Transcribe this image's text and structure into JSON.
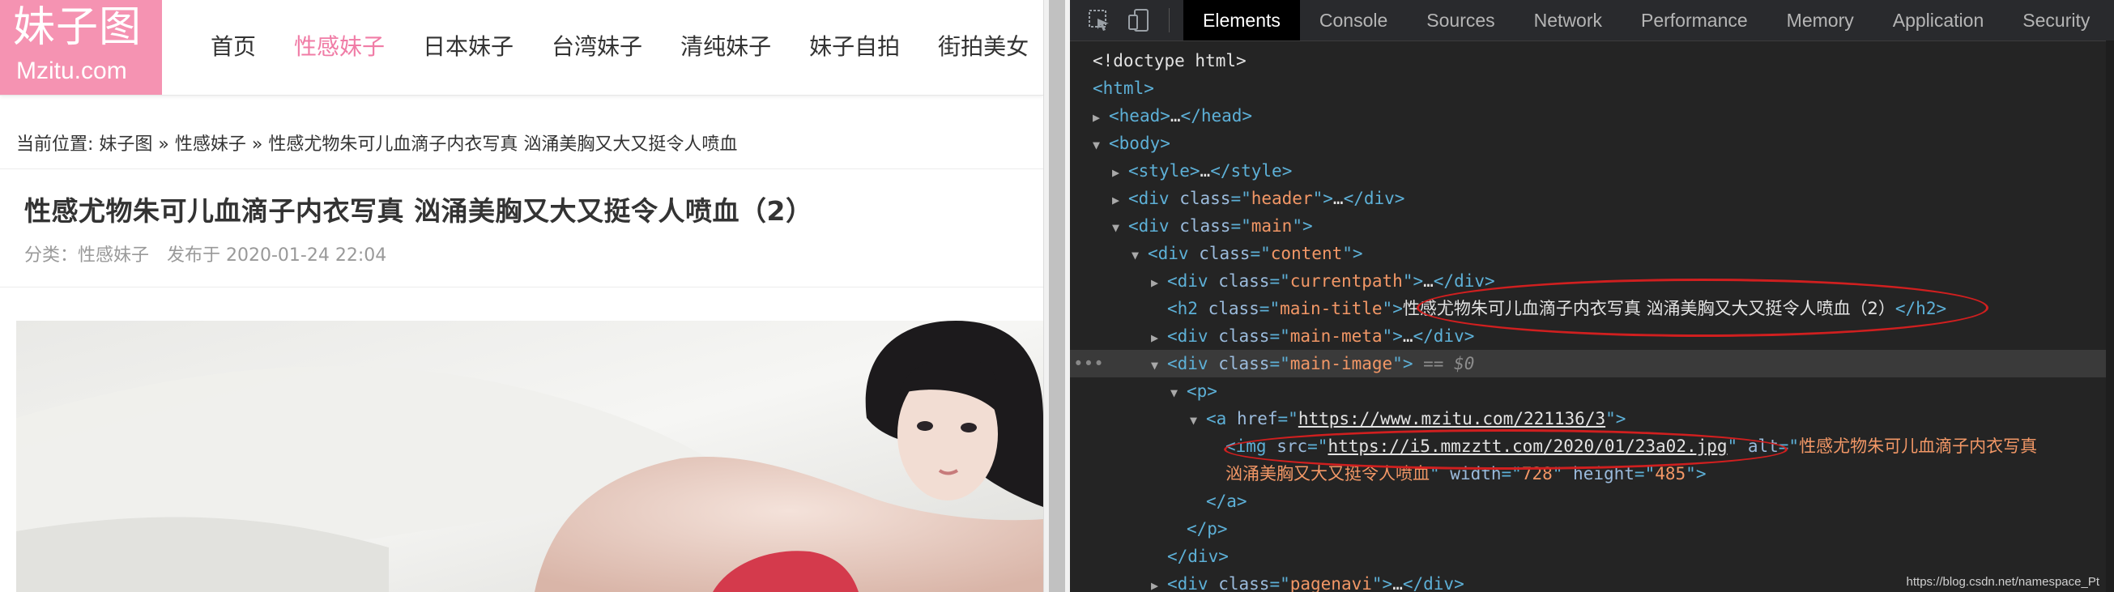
{
  "site": {
    "logo": {
      "cn": "妹子图",
      "en": "Mzitu.com"
    },
    "nav": [
      {
        "label": "首页",
        "active": false
      },
      {
        "label": "性感妹子",
        "active": true
      },
      {
        "label": "日本妹子",
        "active": false
      },
      {
        "label": "台湾妹子",
        "active": false
      },
      {
        "label": "清纯妹子",
        "active": false
      },
      {
        "label": "妹子自拍",
        "active": false
      },
      {
        "label": "街拍美女",
        "active": false
      }
    ],
    "breadcrumb": {
      "prefix": "当前位置: ",
      "home": "妹子图",
      "sep1": " » ",
      "category": "性感妹子",
      "sep2": " » ",
      "current": "性感尤物朱可儿血滴子内衣写真 汹涌美胸又大又挺令人喷血"
    },
    "title": "性感尤物朱可儿血滴子内衣写真 汹涌美胸又大又挺令人喷血（2）",
    "meta": {
      "category": "分类：性感妹子",
      "published": "发布于 2020-01-24 22:04"
    }
  },
  "devtools": {
    "tabs": [
      {
        "label": "Elements",
        "active": true
      },
      {
        "label": "Console",
        "active": false
      },
      {
        "label": "Sources",
        "active": false
      },
      {
        "label": "Network",
        "active": false
      },
      {
        "label": "Performance",
        "active": false
      },
      {
        "label": "Memory",
        "active": false
      },
      {
        "label": "Application",
        "active": false
      },
      {
        "label": "Security",
        "active": false
      }
    ],
    "icons": [
      "inspect-element-icon",
      "device-toolbar-icon"
    ],
    "dom": {
      "doctype": "<!doctype html>",
      "html_open": "<html>",
      "head_tag": "head",
      "body_tag": "body",
      "style_tag": "style",
      "header_class": "header",
      "main_class": "main",
      "content_class": "content",
      "currentpath_class": "currentpath",
      "h2_class": "main-title",
      "h2_text": "性感尤物朱可儿血滴子内衣写真 汹涌美胸又大又挺令人喷血（2）",
      "meta_class": "main-meta",
      "image_class": "main-image",
      "selected_marker": "== $0",
      "a_href": "https://www.mzitu.com/221136/3",
      "img_src": "https://i5.mmzztt.com/2020/01/23a02.jpg",
      "img_alt_1": "性感尤物朱可儿血滴子内衣写真",
      "img_alt_2": "汹涌美胸又大又挺令人喷血",
      "img_width": "728",
      "img_height": "485",
      "pagenavi_class": "pagenavi"
    },
    "watermark": "https://blog.csdn.net/namespace_Pt"
  },
  "colors": {
    "logo_bg": "#f593b2",
    "nav_active": "#f07ca6",
    "annotation": "#d01f1f"
  }
}
